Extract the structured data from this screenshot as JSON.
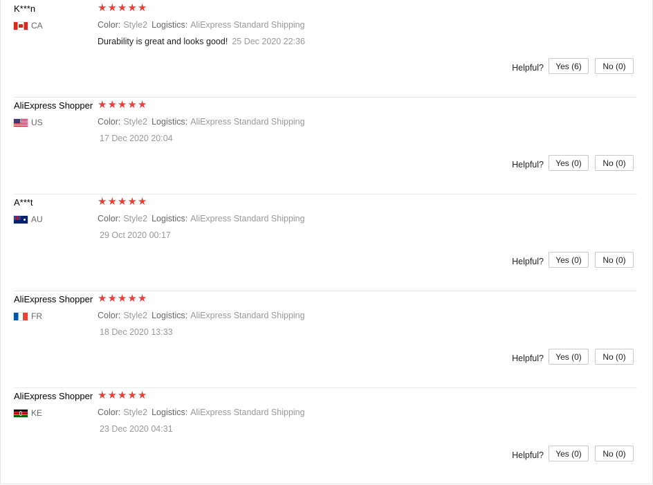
{
  "helpful_label": "Helpful?",
  "color_label": "Color:",
  "logistics_label": "Logistics:",
  "star_color": "#e8413a",
  "reviews": [
    {
      "user": "K***n",
      "flag": "flag-ca",
      "country": "CA",
      "stars": 5,
      "color": "Style2",
      "logistics": "AliExpress Standard Shipping",
      "text": "Durability is great and looks good!",
      "date": "25 Dec 2020 22:36",
      "yes": "Yes (6)",
      "no": "No (0)"
    },
    {
      "user": "AliExpress Shopper",
      "flag": "flag-us",
      "country": "US",
      "stars": 5,
      "color": "Style2",
      "logistics": "AliExpress Standard Shipping",
      "text": "",
      "date": "17 Dec 2020 20:04",
      "yes": "Yes (0)",
      "no": "No (0)"
    },
    {
      "user": "A***t",
      "flag": "flag-au",
      "country": "AU",
      "stars": 5,
      "color": "Style2",
      "logistics": "AliExpress Standard Shipping",
      "text": "",
      "date": "29 Oct 2020 00:17",
      "yes": "Yes (0)",
      "no": "No (0)"
    },
    {
      "user": "AliExpress Shopper",
      "flag": "flag-fr",
      "country": "FR",
      "stars": 5,
      "color": "Style2",
      "logistics": "AliExpress Standard Shipping",
      "text": "",
      "date": "18 Dec 2020 13:33",
      "yes": "Yes (0)",
      "no": "No (0)"
    },
    {
      "user": "AliExpress Shopper",
      "flag": "flag-ke",
      "country": "KE",
      "stars": 5,
      "color": "Style2",
      "logistics": "AliExpress Standard Shipping",
      "text": "",
      "date": "23 Dec 2020 04:31",
      "yes": "Yes (0)",
      "no": "No (0)"
    }
  ]
}
